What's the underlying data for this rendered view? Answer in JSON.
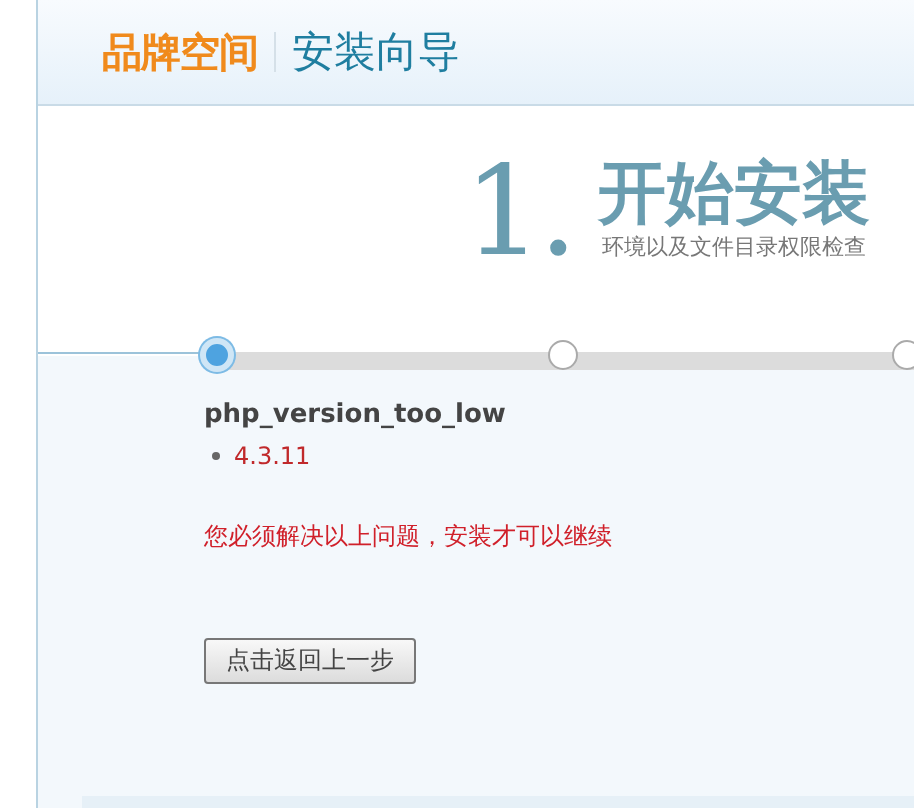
{
  "header": {
    "brand": "品牌空间",
    "title": "安装向导"
  },
  "step": {
    "number": "1.",
    "title": "开始安装",
    "subtitle": "环境以及文件目录权限检查"
  },
  "steps": [
    {
      "selected": true
    },
    {
      "selected": false
    },
    {
      "selected": false
    }
  ],
  "errors": [
    {
      "name": "php_version_too_low",
      "items": [
        "4.3.11"
      ]
    }
  ],
  "message": "您必须解决以上问题，安装才可以继续",
  "back_button": "点击返回上一步"
}
